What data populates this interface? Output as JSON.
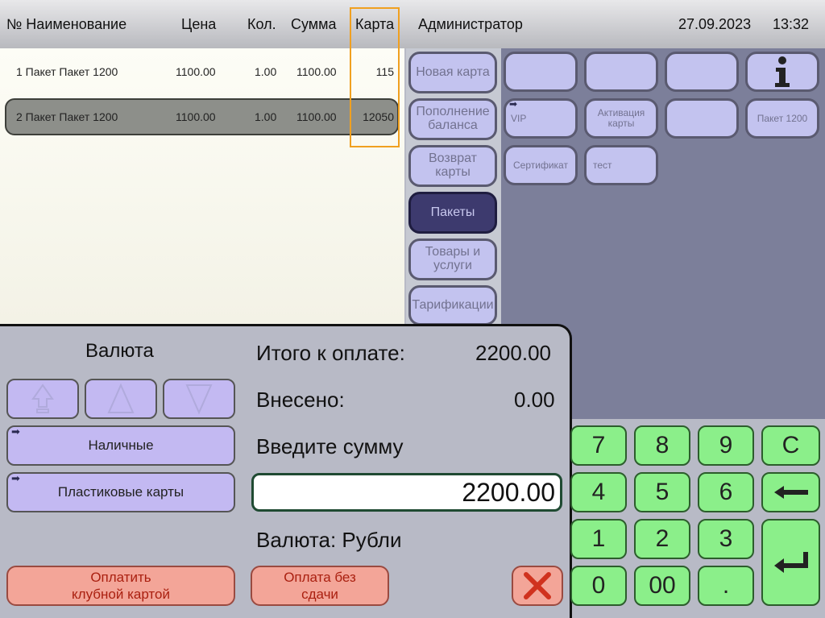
{
  "header": {
    "col_num_name": "№ Наименование",
    "col_price": "Цена",
    "col_qty": "Кол.",
    "col_sum": "Сумма",
    "col_card": "Карта",
    "user": "Администратор",
    "date": "27.09.2023",
    "time": "13:32"
  },
  "rows": [
    {
      "name": "1 Пакет Пакет 1200",
      "price": "1100.00",
      "qty": "1.00",
      "sum": "1100.00",
      "card": "115"
    },
    {
      "name": "2 Пакет Пакет 1200",
      "price": "1100.00",
      "qty": "1.00",
      "sum": "1100.00",
      "card": "12050"
    }
  ],
  "categories": [
    "Новая карта",
    "Пополнение баланса",
    "Возврат карты",
    "Пакеты",
    "Товары и услуги",
    "Тарификации"
  ],
  "items": {
    "r2c1": "VIP",
    "r2c2": "Активация карты",
    "r2c4": "Пакет 1200",
    "r3c1": "Сертификат",
    "r3c2": "тест"
  },
  "payment": {
    "currency_title": "Валюта",
    "cash": "Наличные",
    "cards": "Пластиковые карты",
    "club_card": "Оплатить клубной картой",
    "no_change": "Оплата без сдачи"
  },
  "totals": {
    "total_label": "Итого к оплате:",
    "total_value": "2200.00",
    "paid_label": "Внесено:",
    "paid_value": "0.00",
    "enter_label": "Введите сумму",
    "amount": "2200.00",
    "currency_line": "Валюта: Рубли"
  },
  "keypad": {
    "k7": "7",
    "k8": "8",
    "k9": "9",
    "clear": "C",
    "k4": "4",
    "k5": "5",
    "k6": "6",
    "k1": "1",
    "k2": "2",
    "k3": "3",
    "k0": "0",
    "k00": "00",
    "dot": "."
  },
  "icons": {
    "info": "info-icon",
    "backspace": "backspace-arrow-icon",
    "enter": "enter-return-icon",
    "cancel": "cancel-x-icon"
  },
  "colors": {
    "keypad_green": "#8bef8a",
    "cancel_red": "#d0321e",
    "selected_category": "#3d3a6e",
    "card_highlight": "#f0a020"
  }
}
